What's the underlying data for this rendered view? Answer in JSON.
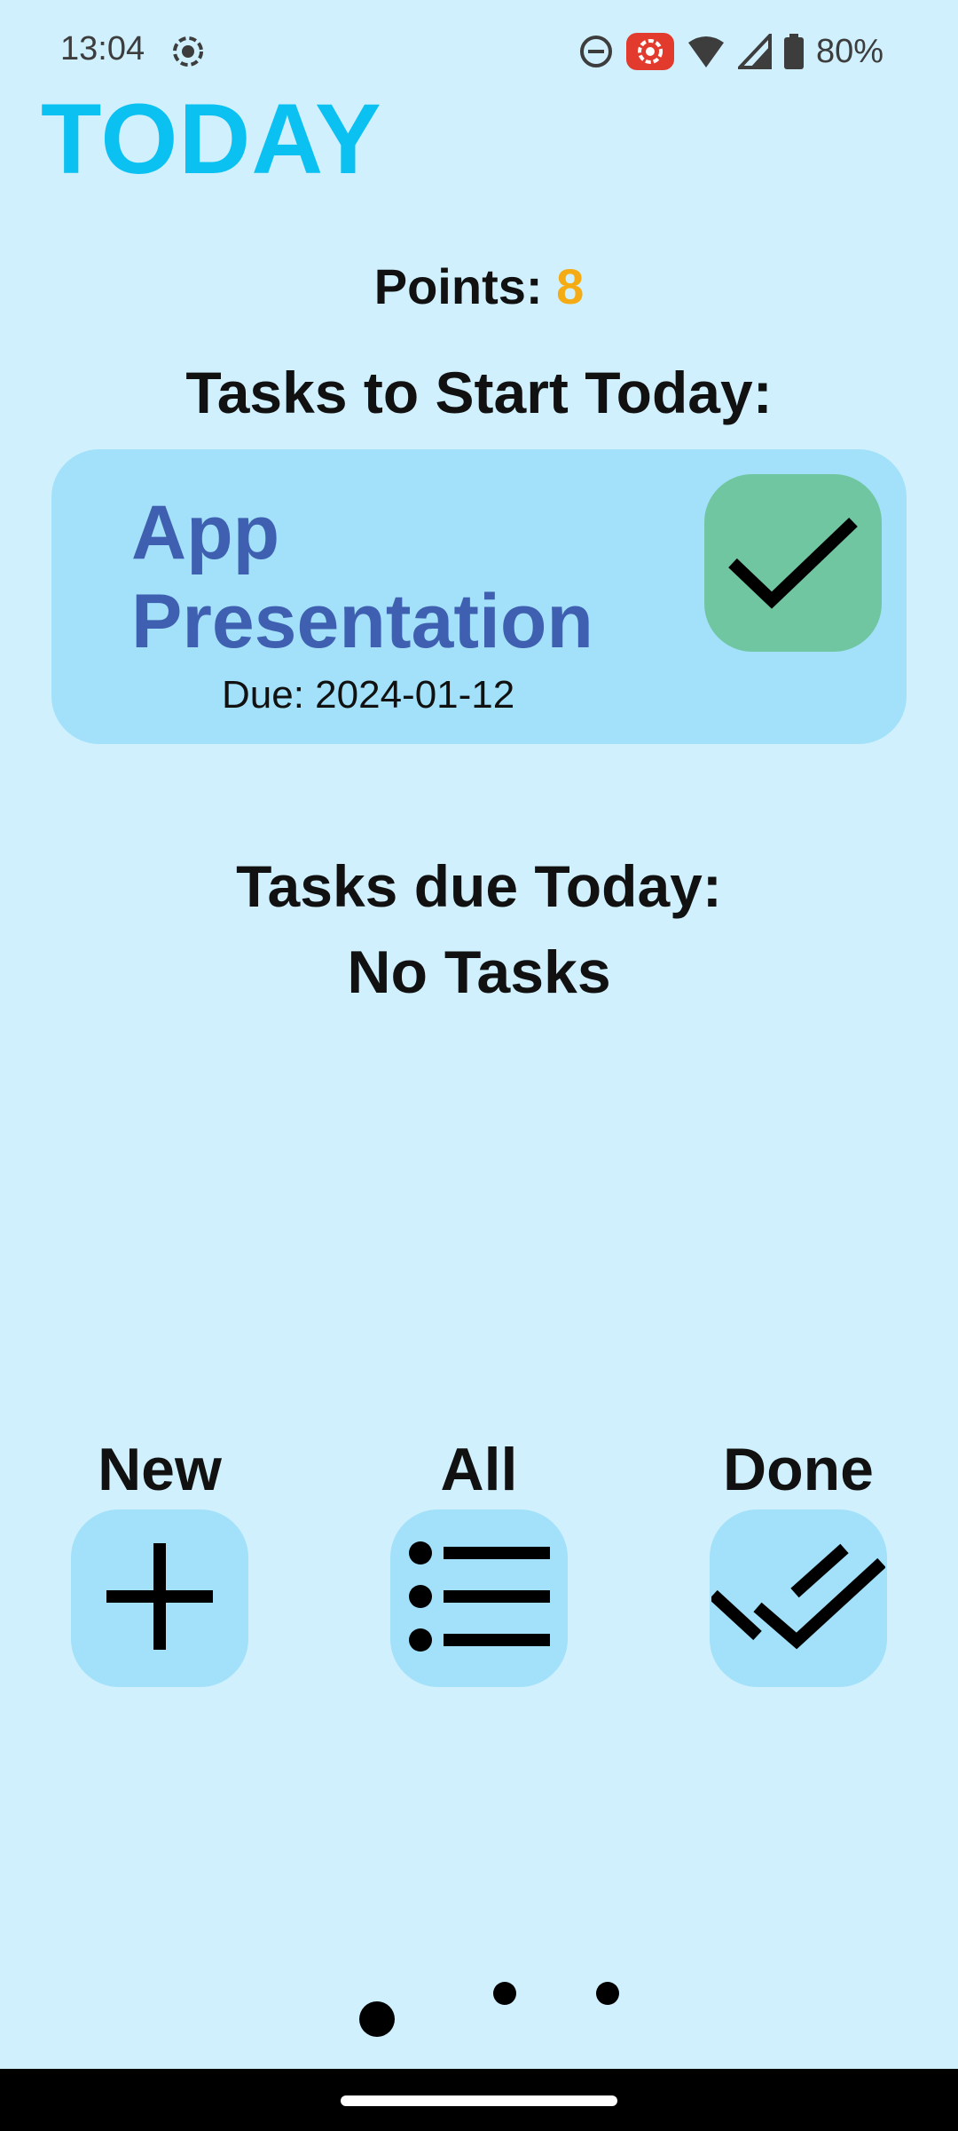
{
  "status_bar": {
    "time": "13:04",
    "battery": "80%",
    "icons": [
      "screen-record-icon",
      "do-not-disturb-icon",
      "recording-indicator-icon",
      "wifi-icon",
      "signal-icon",
      "battery-icon"
    ]
  },
  "app": {
    "title": "TODAY",
    "accent_color": "#0bc1f1"
  },
  "points": {
    "label": "Points:",
    "value": "8",
    "value_color": "#f5ab14"
  },
  "start_today": {
    "heading": "Tasks to Start Today:",
    "tasks": [
      {
        "name": "App Presentation",
        "due": "Due: 2024-01-12",
        "action_icon": "check-icon"
      }
    ]
  },
  "due_today": {
    "heading": "Tasks due Today:",
    "empty_text": "No Tasks"
  },
  "bottom_nav": [
    {
      "label": "New",
      "icon": "plus-icon"
    },
    {
      "label": "All",
      "icon": "list-icon"
    },
    {
      "label": "Done",
      "icon": "double-check-icon"
    }
  ],
  "page_indicator": {
    "pages": 3,
    "active_index": 0
  }
}
